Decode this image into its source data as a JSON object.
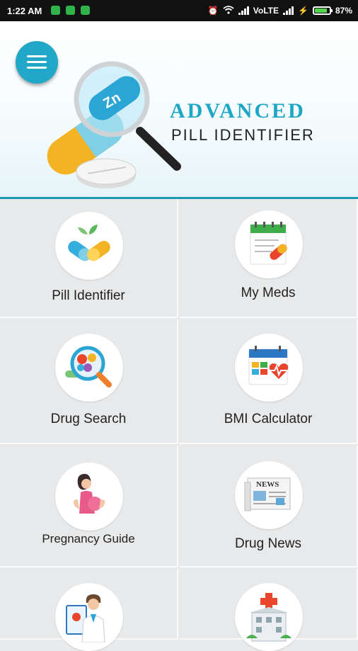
{
  "status_bar": {
    "time": "1:22 AM",
    "network": "VoLTE",
    "battery": "87%",
    "battery_level": 0.87
  },
  "header": {
    "title_line1": "ADVANCED",
    "title_line2": "PILL IDENTIFIER",
    "pill_letters": "Zn",
    "menu_icon": "hamburger-menu-icon"
  },
  "colors": {
    "accent": "#21a7c8",
    "title": "#1ea6c6",
    "tile_bg": "#e8e9ea"
  },
  "tiles": [
    {
      "label": "Pill Identifier",
      "icon": "pill-identifier-icon"
    },
    {
      "label": "My Meds",
      "icon": "calendar-meds-icon"
    },
    {
      "label": "Drug Search",
      "icon": "magnifier-pills-icon"
    },
    {
      "label": "BMI Calculator",
      "icon": "calculator-heart-icon"
    },
    {
      "label": "Pregnancy Guide",
      "icon": "pregnant-woman-icon"
    },
    {
      "label": "Drug News",
      "icon": "newspaper-icon"
    },
    {
      "label": "",
      "icon": "doctor-clipboard-icon"
    },
    {
      "label": "",
      "icon": "hospital-icon"
    }
  ]
}
